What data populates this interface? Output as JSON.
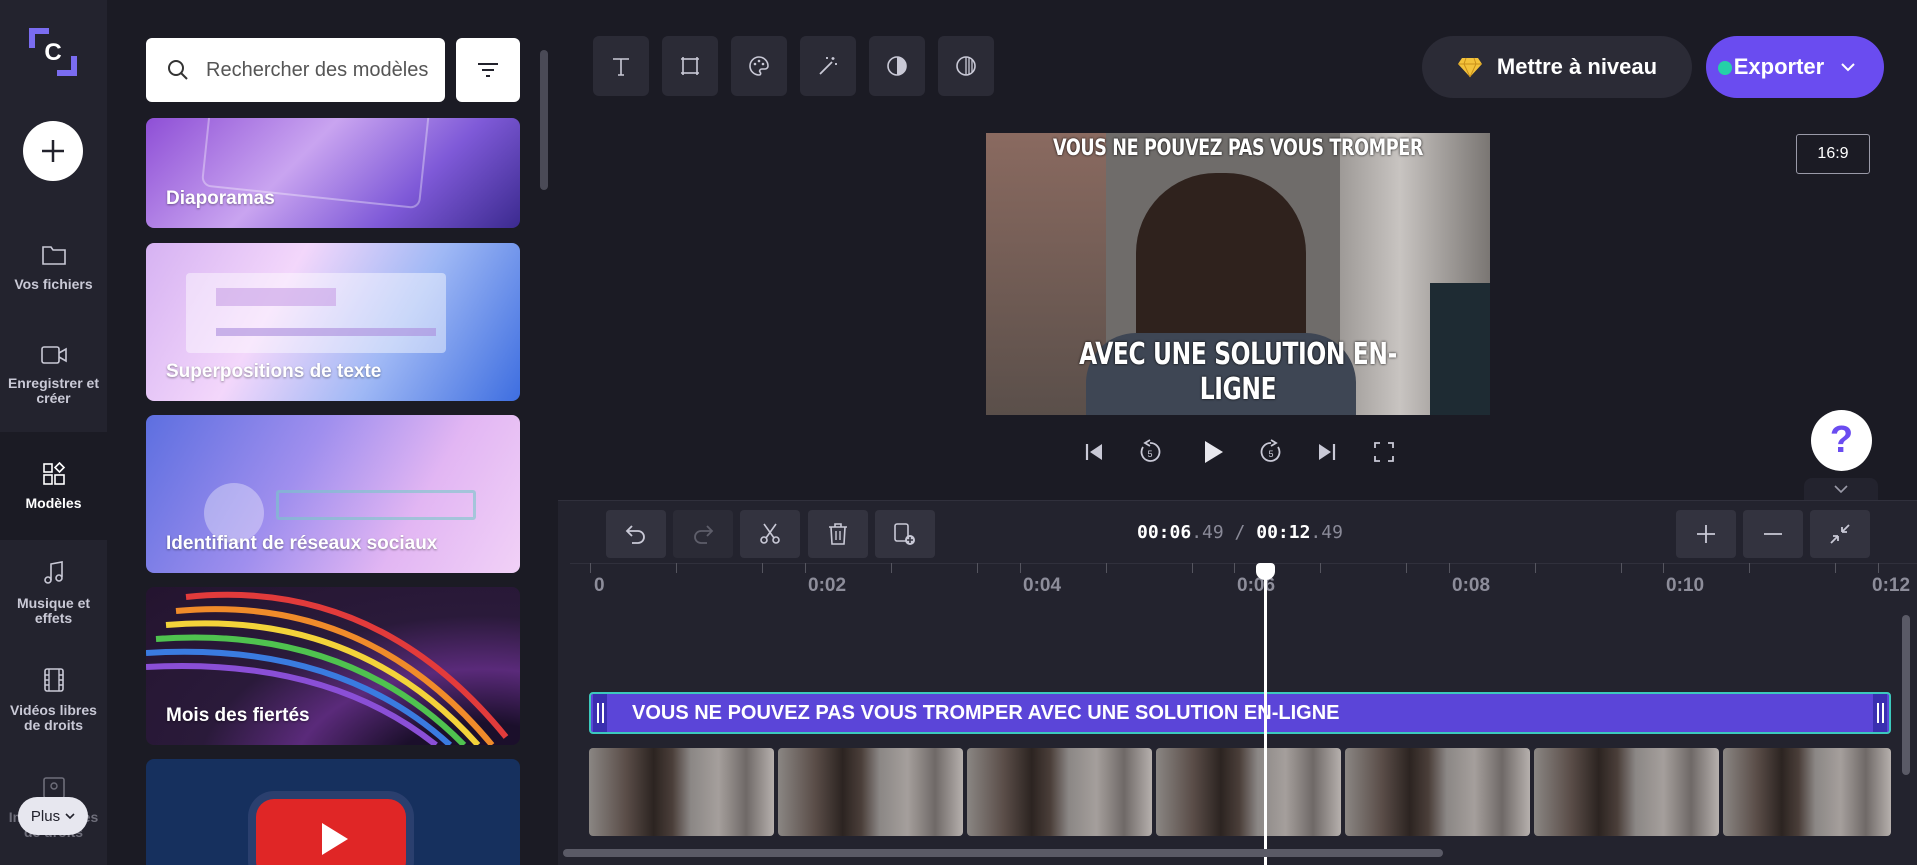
{
  "app": {
    "colors": {
      "accent": "#6a4cf0",
      "clip": "#5b45d8",
      "clip_border": "#3cc9bd",
      "background": "#1b1b24"
    }
  },
  "rail": {
    "items": [
      {
        "label": "Vos fichiers",
        "icon": "folder-icon"
      },
      {
        "label": "Enregistrer et créer",
        "icon": "camera-icon"
      },
      {
        "label": "Modèles",
        "icon": "templates-icon",
        "active": true
      },
      {
        "label": "Musique et effets",
        "icon": "music-icon"
      },
      {
        "label": "Vidéos libres de droits",
        "icon": "film-icon"
      },
      {
        "label": "Images libres de droits",
        "icon": "image-icon"
      }
    ],
    "more_label": "Plus"
  },
  "panel": {
    "search_placeholder": "Rechercher des modèles",
    "cards": [
      {
        "label": "Diaporamas"
      },
      {
        "label": "Superpositions de texte"
      },
      {
        "label": "Identifiant de réseaux sociaux"
      },
      {
        "label": "Mois des fiertés"
      },
      {
        "label": ""
      }
    ]
  },
  "header": {
    "upgrade_label": "Mettre à niveau",
    "export_label": "Exporter",
    "aspect_ratio": "16:9"
  },
  "preview": {
    "top_text": "VOUS NE POUVEZ PAS VOUS TROMPER",
    "bottom_text": "AVEC UNE SOLUTION EN-LIGNE"
  },
  "timeline": {
    "current_time": "00:06",
    "current_frac": ".49",
    "separator": "/",
    "total_time": "00:12",
    "total_frac": ".49",
    "ruler_labels": [
      "0",
      "0:02",
      "0:04",
      "0:06",
      "0:08",
      "0:10",
      "0:12"
    ],
    "text_clip": "VOUS NE POUVEZ PAS VOUS TROMPER AVEC UNE SOLUTION EN-LIGNE"
  }
}
